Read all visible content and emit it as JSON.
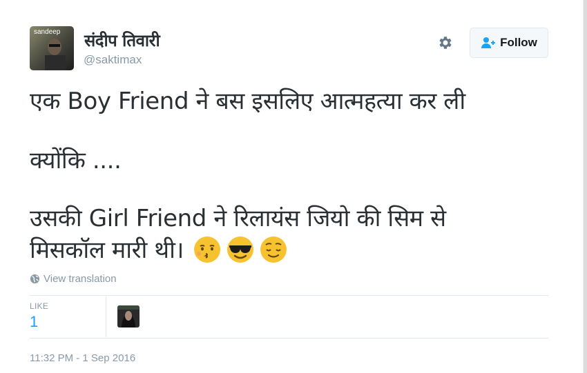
{
  "user": {
    "display_name": "संदीप तिवारी",
    "username": "@saktimax",
    "avatar_overlay_text": "sandeep"
  },
  "header": {
    "follow_label": "Follow",
    "gear_icon": "gear-icon",
    "follow_icon": "add-user-icon"
  },
  "tweet": {
    "line1": "एक Boy Friend ने बस इसलिए आत्महत्या कर ली",
    "line2": "क्योंकि ....",
    "line3": "उसकी Girl Friend ने रिलायंस जियो की सिम से",
    "line4": "मिसकॉल मारी थी।",
    "emojis": [
      "kissing-face-icon",
      "smiling-face-with-sunglasses-icon",
      "relieved-face-icon"
    ]
  },
  "translation": {
    "label": "View translation",
    "icon": "globe-icon"
  },
  "stats": {
    "likes_label": "LIKE",
    "likes_count": "1"
  },
  "meta": {
    "timestamp": "11:32 PM - 1 Sep 2016"
  },
  "colors": {
    "link_blue": "#1da1f2",
    "muted": "#8899a6",
    "text": "#292f33",
    "emoji_yellow": "#f7c22f"
  }
}
